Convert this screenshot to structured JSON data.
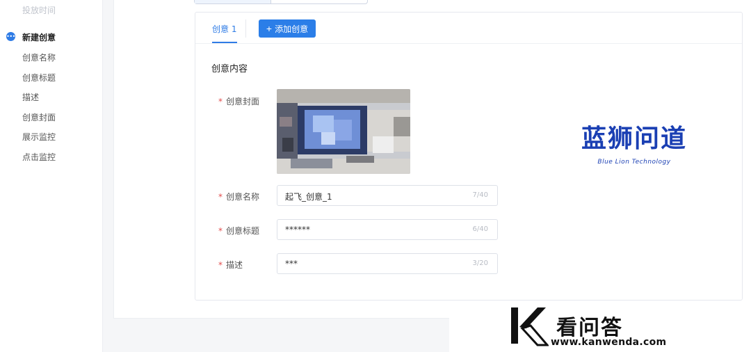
{
  "sidebar": {
    "faded_item": "投放时间",
    "items": [
      {
        "label": "新建创意",
        "active": true
      },
      {
        "label": "创意名称"
      },
      {
        "label": "创意标题"
      },
      {
        "label": "描述"
      },
      {
        "label": "创意封面"
      },
      {
        "label": "展示监控"
      },
      {
        "label": "点击监控"
      }
    ],
    "active_dot_icon": "more-dots-icon"
  },
  "tabs": {
    "active_tab": "创意 1",
    "add_button": "添加创意",
    "add_icon": "plus-icon"
  },
  "form": {
    "section_title": "创意内容",
    "cover_label": "创意封面",
    "name_label": "创意名称",
    "name_value": "起飞_创意_1",
    "name_count": "7/40",
    "title_label": "创意标题",
    "title_value": "******",
    "title_count": "6/40",
    "desc_label": "描述",
    "desc_value": "***",
    "desc_count": "3/20",
    "required_mark": "*"
  },
  "watermarks": {
    "lanshi_cn": "蓝狮问道",
    "lanshi_en": "Blue Lion Technology",
    "kanwenda_cn": "看问答",
    "kanwenda_url": "www.kanwenda.com"
  },
  "colors": {
    "accent": "#2f7ce6",
    "required": "#e34d4d",
    "watermark_blue": "#1a3fb3"
  }
}
